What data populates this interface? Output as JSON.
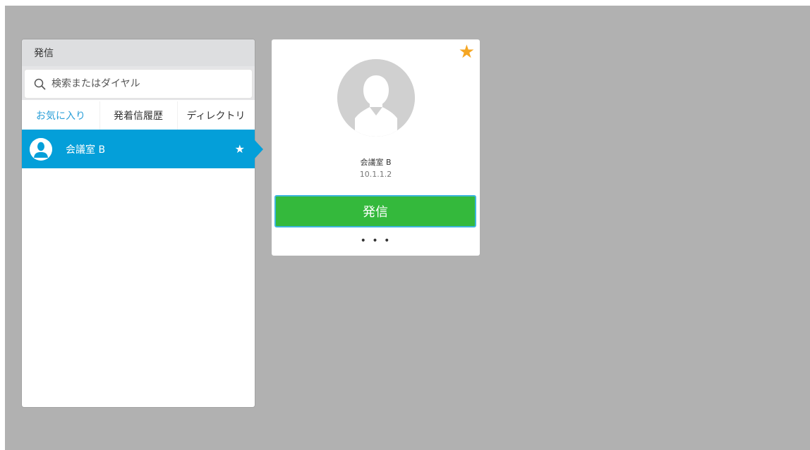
{
  "call_panel": {
    "title": "発信",
    "search": {
      "placeholder": "検索またはダイヤル",
      "value": "",
      "icon": "search-icon"
    },
    "tabs": [
      {
        "label": "お気に入り",
        "active": true
      },
      {
        "label": "発着信履歴",
        "active": false
      },
      {
        "label": "ディレクトリ",
        "active": false
      }
    ],
    "contacts": [
      {
        "name": "会議室 B",
        "favorite": true,
        "selected": true,
        "star": "★"
      }
    ]
  },
  "detail_card": {
    "favorite_star": "★",
    "name": "会議室 B",
    "address": "10.1.1.2",
    "call_label": "発信",
    "more_label": "• • •"
  },
  "colors": {
    "background": "#b1b1b1",
    "accent_blue": "#049fd9",
    "call_green": "#34b93c",
    "star_orange": "#f5a623",
    "tab_active": "#2a9fd8"
  }
}
